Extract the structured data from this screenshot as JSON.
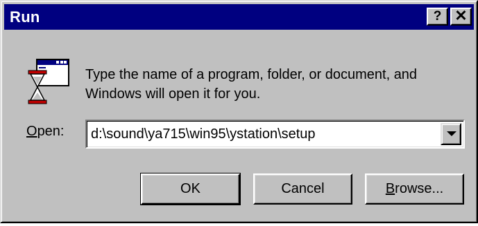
{
  "window": {
    "title": "Run",
    "help_label": "?",
    "close_label": "✕"
  },
  "dialog": {
    "description_line1": "Type the name of a program, folder, or document, and",
    "description_line2": "Windows will open it for you.",
    "open_label_mnemonic": "O",
    "open_label_rest": "pen:",
    "open_value": "d:\\sound\\ya715\\win95\\ystation\\setup",
    "icon": "run-icon"
  },
  "buttons": {
    "ok": "OK",
    "cancel": "Cancel",
    "browse_mnemonic": "B",
    "browse_rest": "rowse..."
  },
  "colors": {
    "titlebar": "#000080",
    "face": "#c0c0c0"
  }
}
